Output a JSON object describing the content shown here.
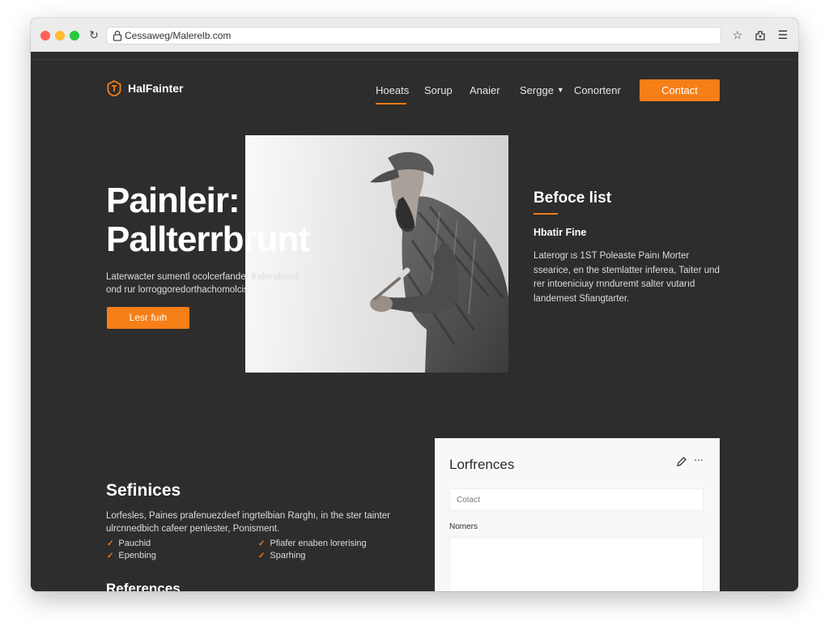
{
  "browser": {
    "url": "Cessaweg/Malerelb.com"
  },
  "brand": {
    "name": "HalFainter"
  },
  "nav": {
    "items": [
      {
        "label": "Hoeats"
      },
      {
        "label": "Sorup"
      },
      {
        "label": "Anaier"
      },
      {
        "label": "Sergge"
      },
      {
        "label": "Conortenr"
      }
    ],
    "contact_label": "Contact"
  },
  "hero": {
    "title_line1": "Painleir:",
    "title_line2": "Pallterrbrunt",
    "subtitle_line1": "Laterwacter sumentl ocolcerfander fralerabecd,",
    "subtitle_line2": "ond rur lorroggoredorthachomolcis.",
    "button_label": "Lesr fuıh"
  },
  "side": {
    "title": "Befoce list",
    "subtitle": "Hbatir Fine",
    "body": "Laterogr ɩs 1ST Poleaste Painı Morter ssearice, en the stemlatter inferea, Taiter und rer intoeniciuɩy rnnduremt salter vutarıd landemest Sfiangtarter."
  },
  "services": {
    "title": "Sefinices",
    "body_line1": "Lorfesles, Paines prafenuezdeef ingrtelbian Rarghı, in the ster tainter",
    "body_line2": "ulrcnnedbich cafeer penlester, Ponisment.",
    "features": [
      {
        "label": "Pauchid"
      },
      {
        "label": "Pfiafer enaben lorerising"
      },
      {
        "label": "Epenbing"
      },
      {
        "label": "Sparhing"
      }
    ]
  },
  "references": {
    "title": "References"
  },
  "form_card": {
    "title": "Lorfrences",
    "input_placeholder": "Cotact",
    "textarea_label": "Nomers"
  },
  "colors": {
    "accent": "#f77f17",
    "page_bg": "#2d2d2d",
    "card_bg": "#f8f8f8"
  }
}
